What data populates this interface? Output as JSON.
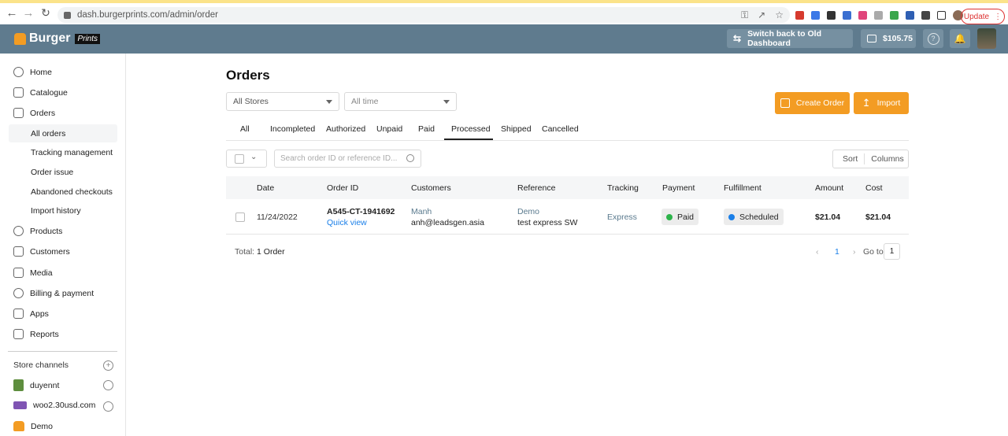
{
  "browser": {
    "url": "dash.burgerprints.com/admin/order",
    "update_label": "Update"
  },
  "header": {
    "logo_text": "Burger",
    "logo_badge": "Prints",
    "switch_label": "Switch back to Old Dashboard",
    "balance": "$105.75",
    "brand_color": "#5f7b8e",
    "accent_color": "#f39c23"
  },
  "sidebar": {
    "items": [
      {
        "label": "Home",
        "icon": "home-icon"
      },
      {
        "label": "Catalogue",
        "icon": "catalogue-icon"
      },
      {
        "label": "Orders",
        "icon": "orders-icon"
      }
    ],
    "order_subitems": [
      "All orders",
      "Tracking management",
      "Order issue",
      "Abandoned checkouts",
      "Import history"
    ],
    "items2": [
      {
        "label": "Products",
        "icon": "products-icon"
      },
      {
        "label": "Customers",
        "icon": "customers-icon"
      },
      {
        "label": "Media",
        "icon": "media-icon"
      },
      {
        "label": "Billing & payment",
        "icon": "billing-icon"
      },
      {
        "label": "Apps",
        "icon": "apps-icon"
      },
      {
        "label": "Reports",
        "icon": "reports-icon"
      }
    ],
    "store_channels_label": "Store channels",
    "stores": [
      {
        "name": "duyennt",
        "icon": "shopify-icon"
      },
      {
        "name": "woo2.30usd.com",
        "icon": "woocommerce-icon"
      },
      {
        "name": "Demo",
        "icon": "burger-icon"
      }
    ]
  },
  "main": {
    "title": "Orders",
    "store_filter": "All Stores",
    "time_filter": "All time",
    "create_order_label": "Create Order",
    "import_label": "Import",
    "tabs": [
      "All",
      "Incompleted",
      "Authorized",
      "Unpaid",
      "Paid",
      "Processed",
      "Shipped",
      "Cancelled"
    ],
    "active_tab": "Processed",
    "search_placeholder": "Search order ID or reference ID...",
    "sort_label": "Sort",
    "columns_label": "Columns",
    "table": {
      "headers": [
        "Date",
        "Order ID",
        "Customers",
        "Reference",
        "Tracking",
        "Payment",
        "Fulfillment",
        "Amount",
        "Cost"
      ],
      "rows": [
        {
          "date": "11/24/2022",
          "order_id": "A545-CT-1941692",
          "quick_view": "Quick view",
          "customer_name": "Manh",
          "customer_email": "anh@leadsgen.asia",
          "reference_name": "Demo",
          "reference_detail": "test express SW",
          "tracking": "Express",
          "payment": "Paid",
          "payment_color": "#2db34a",
          "fulfillment": "Scheduled",
          "fulfillment_color": "#1a7fe8",
          "amount": "$21.04",
          "cost": "$21.04"
        }
      ]
    },
    "total_prefix": "Total:",
    "total_value": "1 Order",
    "pagination": {
      "current_page": "1",
      "goto_label": "Go to",
      "goto_value": "1"
    }
  }
}
